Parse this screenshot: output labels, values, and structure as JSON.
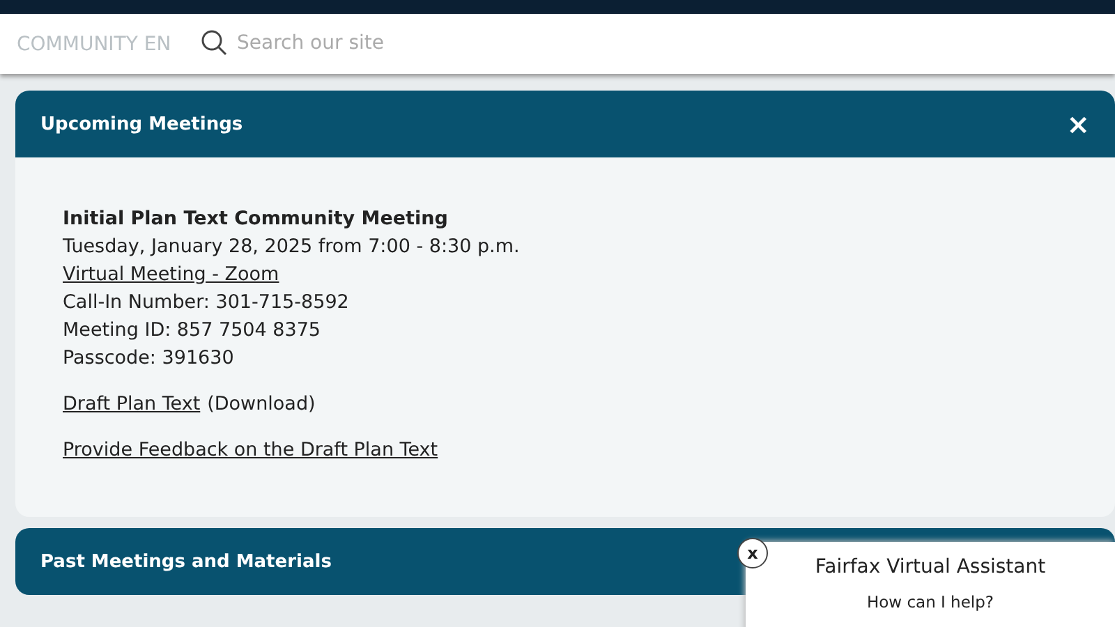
{
  "header": {
    "site_title": "COMMUNITY EN",
    "search": {
      "placeholder": "Search our site"
    }
  },
  "panels": [
    {
      "title": "Upcoming Meetings",
      "expanded": true,
      "close": "×",
      "meeting": {
        "title": "Initial Plan Text Community Meeting",
        "date": "Tuesday, January 28, 2025 from 7:00 - 8:30 p.m.",
        "link": "Virtual Meeting - Zoom",
        "lines": [
          "Call-In Number: 301-715-8592",
          "Meeting ID: 857 7504 8375",
          "Passcode: 391630"
        ]
      },
      "downloads": [
        {
          "link": "Draft Plan Text",
          "note": "(Download)"
        },
        {
          "link": "Provide Feedback on the Draft Plan Text"
        }
      ]
    },
    {
      "title": "Past Meetings and Materials",
      "expanded": false
    }
  ],
  "chat": {
    "close": "x",
    "title": "Fairfax Virtual Assistant",
    "prompt": "How can I help?"
  }
}
